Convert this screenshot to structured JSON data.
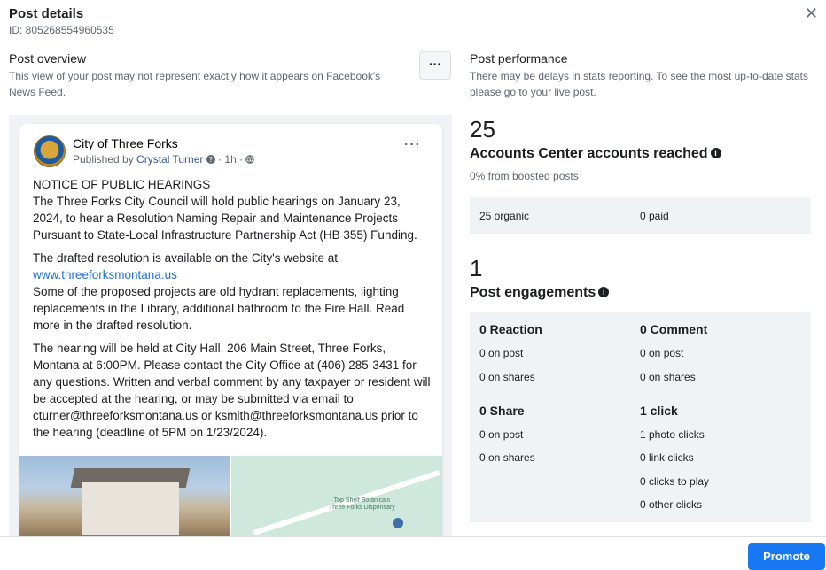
{
  "dialog": {
    "title": "Post details",
    "id_text": "ID: 805268554960535",
    "close_glyph": "✕"
  },
  "overview": {
    "title": "Post overview",
    "subtitle": "This view of your post may not represent exactly how it appears on Facebook's News Feed.",
    "more_label": "···"
  },
  "post": {
    "page_name": "City of Three Forks",
    "published_prefix": "Published by ",
    "author": "Crystal Turner",
    "meta_suffix": " · 1h · ",
    "paragraphs": [
      "NOTICE OF PUBLIC HEARINGS",
      "The Three Forks City Council will hold public hearings on January 23, 2024, to hear a Resolution Naming Repair and Maintenance Projects Pursuant to State-Local Infrastructure Partnership Act (HB 355) Funding.",
      "The drafted resolution is available on the City's website at",
      "www.threeforksmontana.us",
      "Some of the proposed projects are old hydrant replacements, lighting replacements in the Library, additional bathroom to the Fire Hall.  Read more in the drafted resolution.",
      "The hearing will be held at City Hall, 206 Main Street, Three Forks, Montana at 6:00PM.  Please contact the City Office at (406) 285-3431 for any questions.  Written and verbal comment  by any taxpayer or resident will be accepted at the hearing, or may be submitted via email to cturner@threeforksmontana.us or ksmith@threeforksmontana.us prior to the hearing (deadline of 5PM on 1/23/2024)."
    ],
    "map_label_line1": "Top Shelf Botanicals",
    "map_label_line2": "Three Forks Dispensary"
  },
  "performance": {
    "title": "Post performance",
    "subtitle": "There may be delays in stats reporting. To see the most up-to-date stats please go to your live post.",
    "reach_number": "25",
    "reach_title": "Accounts Center accounts reached",
    "reach_sub": "0% from boosted posts",
    "organic": "25 organic",
    "paid": "0 paid",
    "eng_number": "1",
    "eng_title": "Post engagements"
  },
  "engagement": {
    "reaction_head": "0 Reaction",
    "reaction_post": "0 on post",
    "reaction_shares": "0 on shares",
    "comment_head": "0 Comment",
    "comment_post": "0 on post",
    "comment_shares": "0 on shares",
    "share_head": "0 Share",
    "share_post": "0 on post",
    "share_shares": "0 on shares",
    "click_head": "1 click",
    "photo_clicks": "1 photo clicks",
    "link_clicks": "0 link clicks",
    "clicks_to_play": "0 clicks to play",
    "other_clicks": "0 other clicks"
  },
  "footer": {
    "promote_label": "Promote"
  },
  "colors": {
    "accent": "#1877f2",
    "link": "#216fdb",
    "panel_bg": "#f0f2f5"
  },
  "icons": [
    "close-icon",
    "more-icon",
    "info-icon",
    "verified-icon",
    "globe-icon"
  ]
}
